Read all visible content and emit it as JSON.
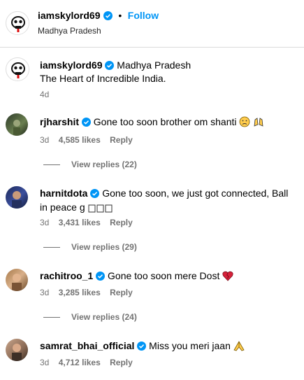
{
  "post": {
    "username": "iamskylord69",
    "location": "Madhya Pradesh",
    "follow_label": "Follow",
    "separator": "•"
  },
  "caption": {
    "username": "iamskylord69",
    "location": "Madhya Pradesh",
    "text": "The Heart of Incredible India.",
    "time": "4d"
  },
  "comments": [
    {
      "username": "rjharshit",
      "text": "Gone too soon brother om shanti",
      "emojis": [
        "sad-face-emoji",
        "raised-hands-emoji"
      ],
      "time": "3d",
      "likes": "4,585 likes",
      "reply": "Reply",
      "view_replies": "View replies (22)"
    },
    {
      "username": "harnitdota",
      "text": "Gone too soon, we just got connected, Ball in peace g",
      "emojis": [
        "unsupported-glyph-boxes"
      ],
      "time": "3d",
      "likes": "3,431 likes",
      "reply": "Reply",
      "view_replies": "View replies (29)"
    },
    {
      "username": "rachitroo_1",
      "text": "Gone too soon mere Dost",
      "emojis": [
        "broken-heart-emoji"
      ],
      "time": "3d",
      "likes": "3,285 likes",
      "reply": "Reply",
      "view_replies": "View replies (24)"
    },
    {
      "username": "samrat_bhai_official",
      "text": "Miss you meri jaan",
      "emojis": [
        "folded-hands-emoji"
      ],
      "time": "3d",
      "likes": "4,712 likes",
      "reply": "Reply"
    }
  ],
  "colors": {
    "accent": "#0095f6",
    "verified": "#0095f6",
    "muted": "#737373",
    "divider": "#dbdbdb"
  }
}
